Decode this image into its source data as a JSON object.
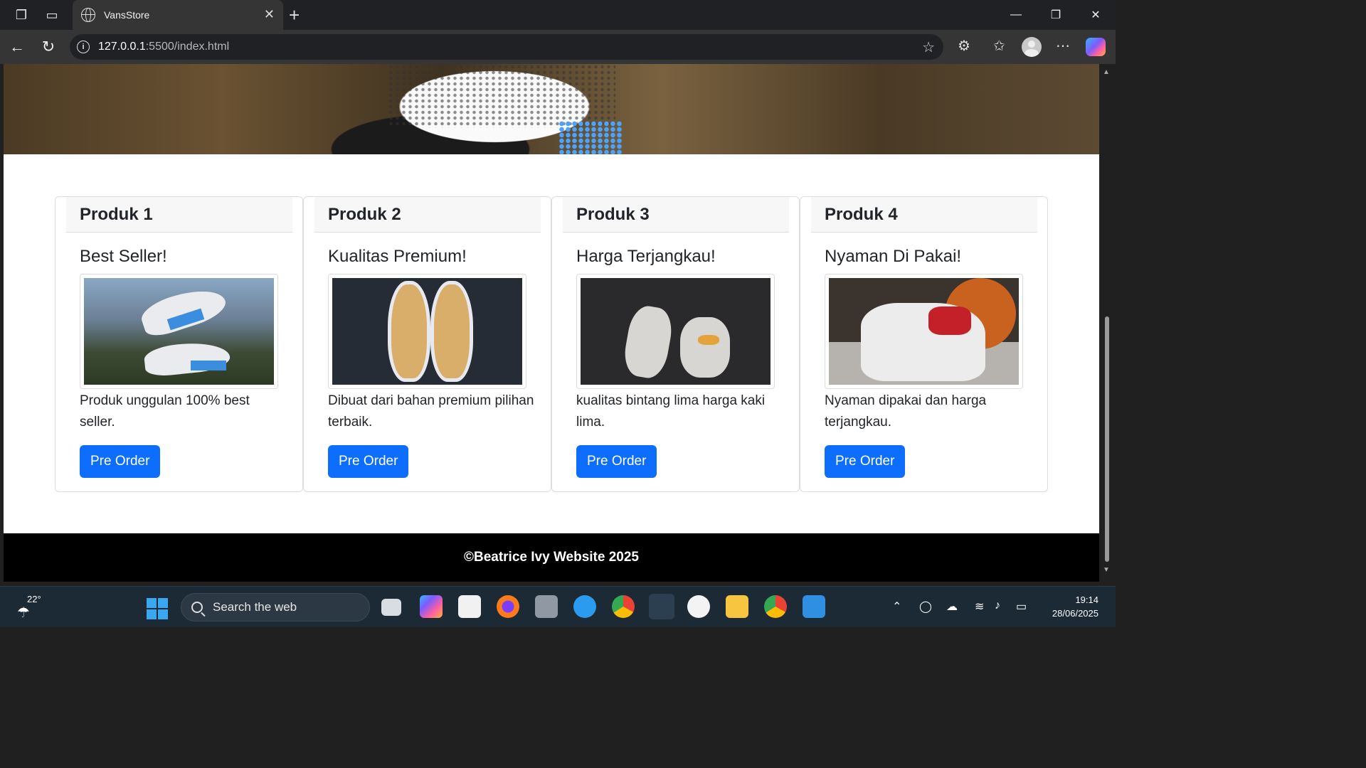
{
  "browser": {
    "tab_title": "VansStore",
    "url_host": "127.0.0.1",
    "url_path": ":5500/index.html"
  },
  "products": [
    {
      "header": "Produk 1",
      "title": "Best Seller!",
      "text": "Produk unggulan 100% best seller.",
      "button": "Pre Order"
    },
    {
      "header": "Produk 2",
      "title": "Kualitas Premium!",
      "text": "Dibuat dari bahan premium pilihan terbaik.",
      "button": "Pre Order"
    },
    {
      "header": "Produk 3",
      "title": "Harga Terjangkau!",
      "text": "kualitas bintang lima harga kaki lima.",
      "button": "Pre Order"
    },
    {
      "header": "Produk 4",
      "title": "Nyaman Di Pakai!",
      "text": "Nyaman dipakai dan harga terjangkau.",
      "button": "Pre Order"
    }
  ],
  "footer": {
    "text": "©Beatrice Ivy Website 2025"
  },
  "taskbar": {
    "weather_temp": "22°",
    "search_placeholder": "Search the web",
    "time": "19:14",
    "date": "28/06/2025"
  },
  "colors": {
    "primary_button": "#0d6efd",
    "footer_bg": "#000000"
  }
}
